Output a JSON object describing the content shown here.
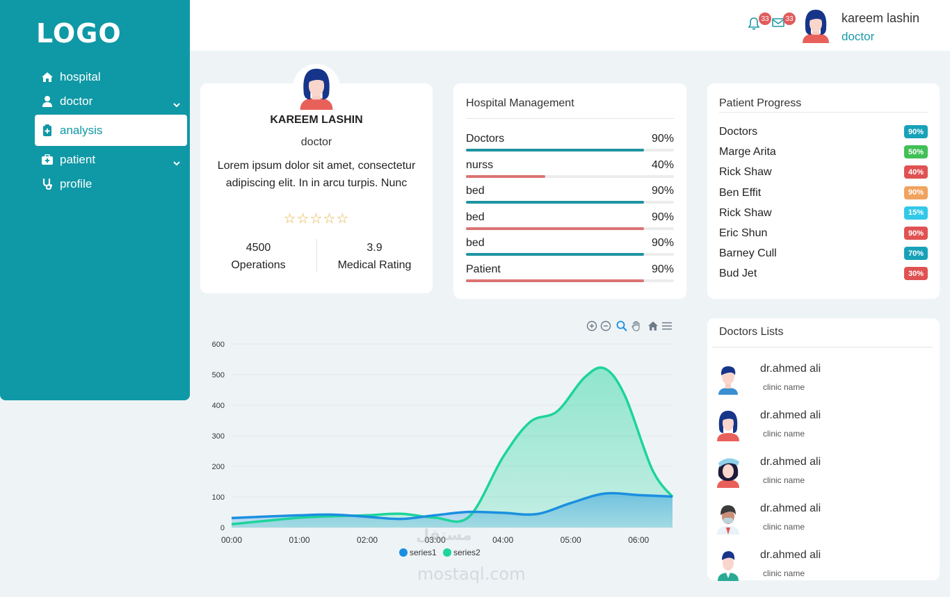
{
  "sidebar": {
    "logo": "LOGO",
    "items": [
      {
        "label": "hospital",
        "icon": "home-icon",
        "active": false,
        "expandable": false
      },
      {
        "label": "doctor",
        "icon": "user-md-icon",
        "active": false,
        "expandable": true
      },
      {
        "label": "analysis",
        "icon": "clipboard-plus-icon",
        "active": true,
        "expandable": false
      },
      {
        "label": "patient",
        "icon": "medkit-icon",
        "active": false,
        "expandable": true
      },
      {
        "label": "profile",
        "icon": "stethoscope-icon",
        "active": false,
        "expandable": false
      }
    ]
  },
  "header": {
    "notifications_count": "33",
    "messages_count": "33",
    "user_name": "kareem lashin",
    "user_role": "doctor"
  },
  "profile": {
    "name": "KAREEM LASHIN",
    "role": "doctor",
    "description": "Lorem ipsum dolor sit amet, consectetur adipiscing elit. In in arcu turpis. Nunc",
    "stars": "☆☆☆☆☆",
    "rating_stars": 0,
    "stats": [
      {
        "value": "4500",
        "label": "Operations"
      },
      {
        "value": "3.9",
        "label": "Medical Rating"
      }
    ]
  },
  "hospital_management": {
    "title": "Hospital Management",
    "rows": [
      {
        "label": "Doctors",
        "percent": "90%",
        "value": 0.9,
        "color": "#1e94a0"
      },
      {
        "label": "nurss",
        "percent": "40%",
        "value": 0.4,
        "color": "#db7373"
      },
      {
        "label": "bed",
        "percent": "90%",
        "value": 0.9,
        "color": "#1e94a0"
      },
      {
        "label": "bed",
        "percent": "90%",
        "value": 0.9,
        "color": "#db7373"
      },
      {
        "label": "bed",
        "percent": "90%",
        "value": 0.9,
        "color": "#1e94a0"
      },
      {
        "label": "Patient",
        "percent": "90%",
        "value": 0.9,
        "color": "#db7373"
      }
    ]
  },
  "patient_progress": {
    "title": "Patient Progress",
    "rows": [
      {
        "name": "Doctors",
        "badge": "90%",
        "color": "#17a2b8"
      },
      {
        "name": "Marge Arita",
        "badge": "50%",
        "color": "#40c057"
      },
      {
        "name": "Rick Shaw",
        "badge": "40%",
        "color": "#e05252"
      },
      {
        "name": "Ben Effit",
        "badge": "90%",
        "color": "#f0a35e"
      },
      {
        "name": "Rick Shaw",
        "badge": "15%",
        "color": "#32c8e8"
      },
      {
        "name": "Eric Shun",
        "badge": "90%",
        "color": "#e05252"
      },
      {
        "name": "Barney Cull",
        "badge": "70%",
        "color": "#17a2b8"
      },
      {
        "name": "Bud Jet",
        "badge": "30%",
        "color": "#e05252"
      }
    ]
  },
  "doctors_list": {
    "title": "Doctors Lists",
    "items": [
      {
        "name": "dr.ahmed ali",
        "clinic": "clinic name"
      },
      {
        "name": "dr.ahmed ali",
        "clinic": "clinic name"
      },
      {
        "name": "dr.ahmed ali",
        "clinic": "clinic name"
      },
      {
        "name": "dr.ahmed ali",
        "clinic": "clinic name"
      },
      {
        "name": "dr.ahmed ali",
        "clinic": "clinic name"
      }
    ]
  },
  "watermark": {
    "arabic": "مستقل",
    "latin": "mostaql.com"
  },
  "chart_data": {
    "type": "area",
    "x": [
      "00:00",
      "01:00",
      "02:00",
      "03:00",
      "04:00",
      "05:00",
      "06:00"
    ],
    "xlim": [
      0,
      6.5
    ],
    "ylim": [
      0,
      600
    ],
    "yticks": [
      0,
      100,
      200,
      300,
      400,
      500,
      600
    ],
    "grid": true,
    "legend": "bottom",
    "series": [
      {
        "name": "series1",
        "color": "#1a8fe0",
        "points": [
          [
            0,
            31
          ],
          [
            1,
            40
          ],
          [
            1.5,
            42
          ],
          [
            2,
            35
          ],
          [
            2.5,
            28
          ],
          [
            3,
            40
          ],
          [
            3.5,
            51
          ],
          [
            4,
            48
          ],
          [
            4.5,
            44
          ],
          [
            5,
            80
          ],
          [
            5.5,
            111
          ],
          [
            6,
            106
          ],
          [
            6.5,
            101
          ]
        ]
      },
      {
        "name": "series2",
        "color": "#1dd49b",
        "points": [
          [
            0,
            11
          ],
          [
            1,
            32
          ],
          [
            1.5,
            37
          ],
          [
            2,
            40
          ],
          [
            2.5,
            45
          ],
          [
            3,
            32
          ],
          [
            3.5,
            35
          ],
          [
            4,
            230
          ],
          [
            4.4,
            345
          ],
          [
            4.8,
            380
          ],
          [
            5.2,
            490
          ],
          [
            5.5,
            520
          ],
          [
            5.8,
            430
          ],
          [
            6.2,
            190
          ],
          [
            6.5,
            100
          ]
        ]
      }
    ]
  }
}
